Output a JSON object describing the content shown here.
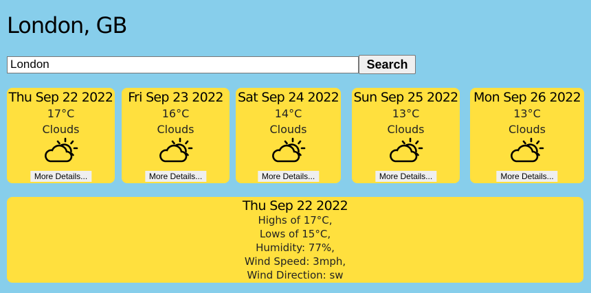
{
  "location": {
    "title": "London, GB"
  },
  "search": {
    "value": "London",
    "button_label": "Search"
  },
  "forecast": [
    {
      "date": "Thu Sep 22 2022",
      "temp": "17°C",
      "condition": "Clouds",
      "icon": "partly-cloudy-icon",
      "details_label": "More Details..."
    },
    {
      "date": "Fri Sep 23 2022",
      "temp": "16°C",
      "condition": "Clouds",
      "icon": "partly-cloudy-icon",
      "details_label": "More Details..."
    },
    {
      "date": "Sat Sep 24 2022",
      "temp": "14°C",
      "condition": "Clouds",
      "icon": "partly-cloudy-icon",
      "details_label": "More Details..."
    },
    {
      "date": "Sun Sep 25 2022",
      "temp": "13°C",
      "condition": "Clouds",
      "icon": "partly-cloudy-icon",
      "details_label": "More Details..."
    },
    {
      "date": "Mon Sep 26 2022",
      "temp": "13°C",
      "condition": "Clouds",
      "icon": "partly-cloudy-icon",
      "details_label": "More Details..."
    }
  ],
  "details": {
    "date": "Thu Sep 22 2022",
    "highs": "Highs of 17°C,",
    "lows": "Lows of 15°C,",
    "humidity": "Humidity: 77%,",
    "wind_speed": "Wind Speed: 3mph,",
    "wind_direction": "Wind Direction: sw"
  },
  "colors": {
    "background": "#87ceeb",
    "card": "#ffe03e"
  }
}
